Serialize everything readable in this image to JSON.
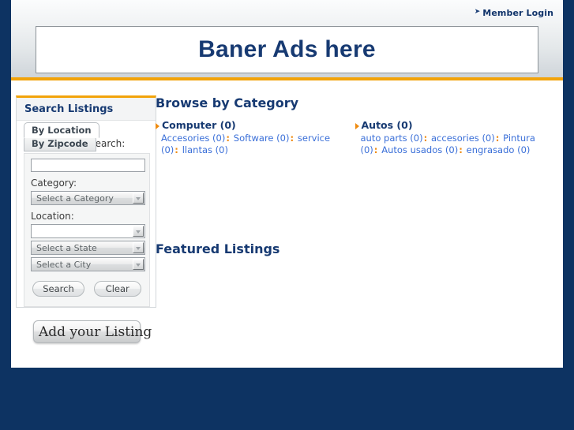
{
  "header": {
    "member_login_label": "Member Login",
    "member_login_arrow": "arrow-icon",
    "banner_text": "Baner Ads here"
  },
  "sidebar": {
    "panel_title": "Search Listings",
    "tabs": [
      {
        "label": "By Location",
        "active": true
      },
      {
        "label": "By Zipcode",
        "active": false
      }
    ],
    "search_label": "Search:",
    "search_input_value": "",
    "category_label": "Category:",
    "category_select_value": "Select a Category",
    "location_label": "Location:",
    "location_input_value": "",
    "state_select_value": "Select a State",
    "city_select_value": "Select a City",
    "search_button_label": "Search",
    "clear_button_label": "Clear",
    "add_listing_label": "Add your Listing"
  },
  "main": {
    "browse_title": "Browse by Category",
    "featured_title": "Featured Listings",
    "categories": [
      {
        "name": "Computer (0)",
        "subcategories": [
          "Accesories (0)",
          "Software (0)",
          "service (0)",
          "llantas (0)"
        ]
      },
      {
        "name": "Autos (0)",
        "subcategories": [
          "auto parts (0)",
          "accesories (0)",
          "Pintura (0)",
          "Autos usados (0)",
          "engrasado (0)"
        ]
      }
    ],
    "separator": ":"
  },
  "colors": {
    "page_background": "#0d3362",
    "accent_orange": "#f2a30a",
    "heading_navy": "#173a72",
    "link_blue": "#3a6fd8",
    "panel_grey": "#f5f6f6"
  }
}
